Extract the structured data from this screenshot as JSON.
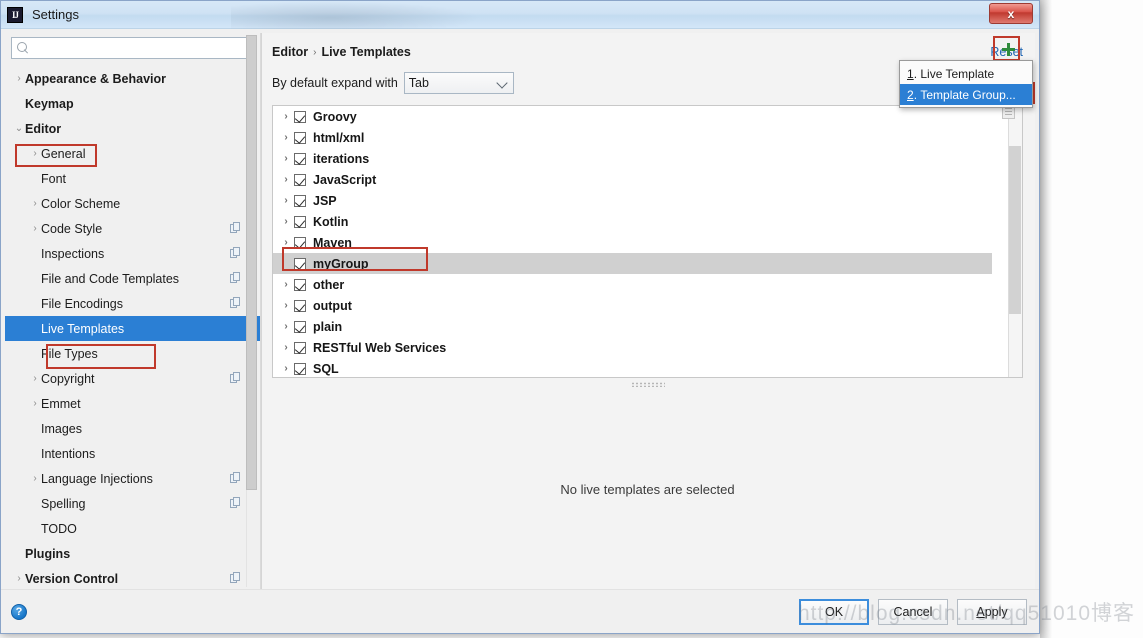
{
  "window": {
    "title": "Settings",
    "app_icon": "IJ",
    "close_label": "x"
  },
  "sidebar": {
    "search": {
      "value": "",
      "placeholder": ""
    },
    "items": [
      {
        "label": "Appearance & Behavior",
        "indent": 0,
        "arrow": "›",
        "bold": true,
        "copy": false,
        "selected": false
      },
      {
        "label": "Keymap",
        "indent": 0,
        "arrow": "",
        "bold": true,
        "copy": false,
        "selected": false
      },
      {
        "label": "Editor",
        "indent": 0,
        "arrow": "⌄",
        "bold": true,
        "copy": false,
        "selected": false
      },
      {
        "label": "General",
        "indent": 1,
        "arrow": "›",
        "bold": false,
        "copy": false,
        "selected": false
      },
      {
        "label": "Font",
        "indent": 1,
        "arrow": "",
        "bold": false,
        "copy": false,
        "selected": false
      },
      {
        "label": "Color Scheme",
        "indent": 1,
        "arrow": "›",
        "bold": false,
        "copy": false,
        "selected": false
      },
      {
        "label": "Code Style",
        "indent": 1,
        "arrow": "›",
        "bold": false,
        "copy": true,
        "selected": false
      },
      {
        "label": "Inspections",
        "indent": 1,
        "arrow": "",
        "bold": false,
        "copy": true,
        "selected": false
      },
      {
        "label": "File and Code Templates",
        "indent": 1,
        "arrow": "",
        "bold": false,
        "copy": true,
        "selected": false
      },
      {
        "label": "File Encodings",
        "indent": 1,
        "arrow": "",
        "bold": false,
        "copy": true,
        "selected": false
      },
      {
        "label": "Live Templates",
        "indent": 1,
        "arrow": "",
        "bold": false,
        "copy": false,
        "selected": true
      },
      {
        "label": "File Types",
        "indent": 1,
        "arrow": "",
        "bold": false,
        "copy": false,
        "selected": false
      },
      {
        "label": "Copyright",
        "indent": 1,
        "arrow": "›",
        "bold": false,
        "copy": true,
        "selected": false
      },
      {
        "label": "Emmet",
        "indent": 1,
        "arrow": "›",
        "bold": false,
        "copy": false,
        "selected": false
      },
      {
        "label": "Images",
        "indent": 1,
        "arrow": "",
        "bold": false,
        "copy": false,
        "selected": false
      },
      {
        "label": "Intentions",
        "indent": 1,
        "arrow": "",
        "bold": false,
        "copy": false,
        "selected": false
      },
      {
        "label": "Language Injections",
        "indent": 1,
        "arrow": "›",
        "bold": false,
        "copy": true,
        "selected": false
      },
      {
        "label": "Spelling",
        "indent": 1,
        "arrow": "",
        "bold": false,
        "copy": true,
        "selected": false
      },
      {
        "label": "TODO",
        "indent": 1,
        "arrow": "",
        "bold": false,
        "copy": false,
        "selected": false
      },
      {
        "label": "Plugins",
        "indent": 0,
        "arrow": "",
        "bold": true,
        "copy": false,
        "selected": false
      },
      {
        "label": "Version Control",
        "indent": 0,
        "arrow": "›",
        "bold": true,
        "copy": true,
        "selected": false
      }
    ]
  },
  "content": {
    "breadcrumb": {
      "parent": "Editor",
      "separator": "›",
      "current": "Live Templates"
    },
    "reset_label": "Reset",
    "expand_label": "By default expand with",
    "expand_value": "Tab",
    "add_button": "+",
    "empty_detail_text": "No live templates are selected",
    "templates": [
      {
        "label": "Groovy",
        "checked": true,
        "expandable": true,
        "highlighted": false
      },
      {
        "label": "html/xml",
        "checked": true,
        "expandable": true,
        "highlighted": false
      },
      {
        "label": "iterations",
        "checked": true,
        "expandable": true,
        "highlighted": false
      },
      {
        "label": "JavaScript",
        "checked": true,
        "expandable": true,
        "highlighted": false
      },
      {
        "label": "JSP",
        "checked": true,
        "expandable": true,
        "highlighted": false
      },
      {
        "label": "Kotlin",
        "checked": true,
        "expandable": true,
        "highlighted": false
      },
      {
        "label": "Maven",
        "checked": true,
        "expandable": true,
        "highlighted": false
      },
      {
        "label": "myGroup",
        "checked": true,
        "expandable": false,
        "highlighted": true
      },
      {
        "label": "other",
        "checked": true,
        "expandable": true,
        "highlighted": false
      },
      {
        "label": "output",
        "checked": true,
        "expandable": true,
        "highlighted": false
      },
      {
        "label": "plain",
        "checked": true,
        "expandable": true,
        "highlighted": false
      },
      {
        "label": "RESTful Web Services",
        "checked": true,
        "expandable": true,
        "highlighted": false
      },
      {
        "label": "SQL",
        "checked": true,
        "expandable": true,
        "highlighted": false
      }
    ],
    "add_menu": [
      {
        "mnemonic": "1",
        "label": "Live Template",
        "selected": false
      },
      {
        "mnemonic": "2",
        "label": "Template Group...",
        "selected": true
      }
    ]
  },
  "footer": {
    "help_label": "?",
    "ok_label": "OK",
    "cancel_label": "Cancel",
    "apply_mnemonic": "A",
    "apply_rest": "pply"
  },
  "watermark": "http://blog.csdn.net/qq51010博客",
  "colors": {
    "selection_blue": "#2b7fd4",
    "annotation_red": "#c0392b",
    "link_blue": "#2166b3",
    "plus_green": "#2e8b3c",
    "row_highlight": "#d0d0d0"
  }
}
